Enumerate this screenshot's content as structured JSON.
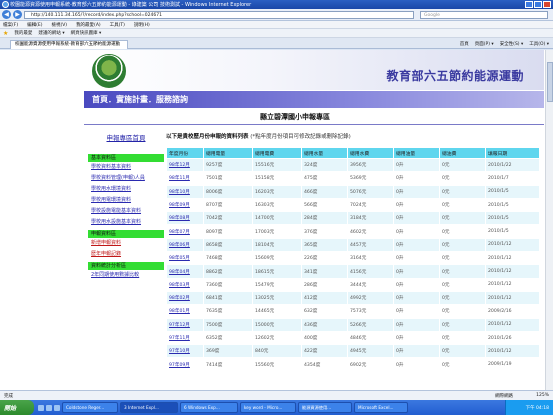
{
  "window": {
    "title": "校園能源資源使用申報系統-教育部六五節約能源運動 - 綠建築 公司 技術測試 - Windows Internet Explorer"
  },
  "address": {
    "url": "http://140.111.34.165/?/record/index.php?school=024671",
    "search_placeholder": "Google"
  },
  "menu": [
    "檔案(F)",
    "編輯(E)",
    "檢視(V)",
    "我的最愛(A)",
    "工具(T)",
    "說明(H)"
  ],
  "favorites": {
    "label": "我的最愛",
    "items": [
      "建議的網站 ▾",
      "網頁快訊圖庫 ▾"
    ]
  },
  "tab": {
    "label": "校園能源資源使用申報系統-教育部六五節約能源運動",
    "tools": [
      "首頁",
      "頁面(P) ▾",
      "安全性(S) ▾",
      "工具(O) ▾"
    ]
  },
  "banner": {
    "title": "教育部六五節約能源運動",
    "nav": "首頁．實施計畫．服務諮詢"
  },
  "school_name": "縣立碧潭國小申報專區",
  "sidebar": {
    "title": "申報專區首頁",
    "sections": [
      {
        "head": "基本資料區",
        "links": [
          "學校資料基本資料",
          "學校資料管理(申報)人員",
          "學校用水環境資料",
          "學校用電環境資料",
          "學校設施電能基本資料",
          "學校用水設施基本資料"
        ]
      },
      {
        "head": "申報資料區",
        "links": [
          "新增申報資料",
          "歷年申報記錄"
        ]
      },
      {
        "head": "資料統計分析區",
        "links": [
          "2年同期使用數據比較"
        ]
      }
    ]
  },
  "main": {
    "heading": "以下是貴校歷月份申報的資料列表",
    "note": "(*點年度月份項目可修改記錄或刪除記錄)"
  },
  "table": {
    "headers": [
      "年度月份",
      "總用電量",
      "總用電費",
      "總用水量",
      "總用水費",
      "總用油量",
      "總油費",
      "填報日期"
    ],
    "rows": [
      [
        "98年12月",
        "9257度",
        "15516元",
        "324度",
        "3956元",
        "0升",
        "0元",
        "2010/1/22"
      ],
      [
        "98年11月",
        "7501度",
        "15158元",
        "475度",
        "5369元",
        "0升",
        "0元",
        "2010/1/7"
      ],
      [
        "98年10月",
        "8006度",
        "16203元",
        "466度",
        "5076元",
        "0升",
        "0元",
        "2010/1/5"
      ],
      [
        "98年09月",
        "8707度",
        "16303元",
        "566度",
        "7024元",
        "0升",
        "0元",
        "2010/1/5"
      ],
      [
        "98年08月",
        "7042度",
        "14700元",
        "284度",
        "3184元",
        "0升",
        "0元",
        "2010/1/5"
      ],
      [
        "98年07月",
        "8097度",
        "17003元",
        "376度",
        "4602元",
        "0升",
        "0元",
        "2010/1/5"
      ],
      [
        "98年06月",
        "8658度",
        "18104元",
        "365度",
        "4457元",
        "0升",
        "0元",
        "2010/1/12"
      ],
      [
        "98年05月",
        "7468度",
        "15609元",
        "226度",
        "3164元",
        "0升",
        "0元",
        "2010/1/12"
      ],
      [
        "98年04月",
        "8862度",
        "18615元",
        "341度",
        "4156元",
        "0升",
        "0元",
        "2010/1/12"
      ],
      [
        "98年03月",
        "7360度",
        "15479元",
        "286度",
        "3444元",
        "0升",
        "0元",
        "2010/1/12"
      ],
      [
        "98年02月",
        "6841度",
        "13025元",
        "412度",
        "4992元",
        "0升",
        "0元",
        "2010/1/12"
      ],
      [
        "98年01月",
        "7635度",
        "14465元",
        "632度",
        "7573元",
        "0升",
        "0元",
        "2009/2/16"
      ],
      [
        "97年12月",
        "7500度",
        "15000元",
        "436度",
        "5266元",
        "0升",
        "0元",
        "2010/1/12"
      ],
      [
        "97年11月",
        "6352度",
        "12602元",
        "400度",
        "4846元",
        "0升",
        "0元",
        "2010/1/26"
      ],
      [
        "97年10月",
        "369度",
        "840元",
        "422度",
        "4945元",
        "0升",
        "0元",
        "2010/1/12"
      ],
      [
        "97年09月",
        "7414度",
        "15560元",
        "4354度",
        "6902元",
        "0升",
        "0元",
        "2009/1/19"
      ]
    ]
  },
  "status": {
    "text": "完成",
    "zone": "網際網路",
    "zoom": "125%"
  },
  "taskbar": {
    "start": "開始",
    "items": [
      "Coldstone Reger...",
      "3 Internet Expl...",
      "6 Windows Exp...",
      "key word - Micro...",
      "能源資源使用...",
      "Microsoft Excel..."
    ],
    "clock": "下午 04:18"
  }
}
